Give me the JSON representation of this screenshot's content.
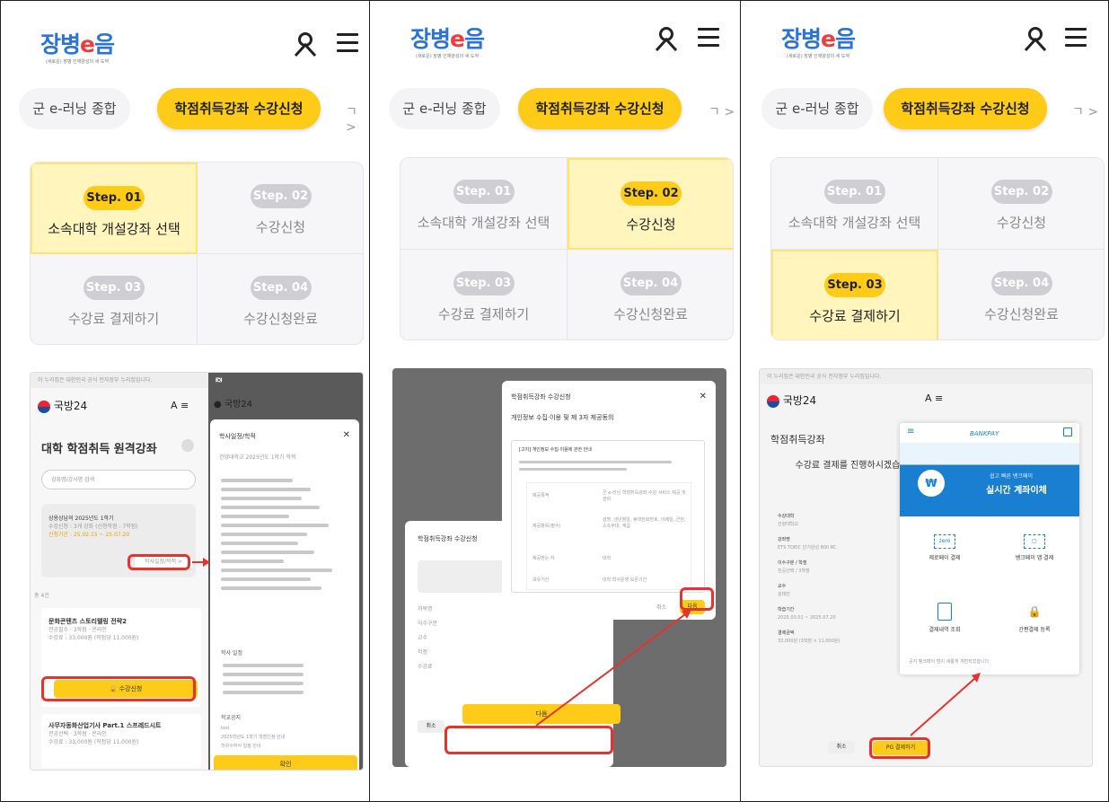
{
  "app": {
    "logo_text_prefix": "장병",
    "logo_text_e": "e",
    "logo_text_suffix": "음",
    "logo_subtitle": "(새로운) 장병 인재양성의 새 도약"
  },
  "tabs": {
    "general": "군 e-러닝 종합",
    "course": "학점취득강좌 수강신청",
    "more": "ㄱ >"
  },
  "steps": [
    {
      "badge": "Step. 01",
      "label": "소속대학 개설강좌 선택"
    },
    {
      "badge": "Step. 02",
      "label": "수강신청"
    },
    {
      "badge": "Step. 03",
      "label": "수강료 결제하기"
    },
    {
      "badge": "Step. 04",
      "label": "수강신청완료"
    }
  ],
  "panels": [
    {
      "active_step": 1
    },
    {
      "active_step": 2
    },
    {
      "active_step": 3
    }
  ],
  "shot1": {
    "notice": "이 누리집은 대한민국 공식 전자정부 누리집입니다.",
    "brand": "국방24",
    "title": "대학 학점취득 원격강좌",
    "search_placeholder": "강좌명/강사명 검색",
    "semester": "상용상남의 2025년도 1학기",
    "apply_info": "수강신청 : 3개 강좌 (신청학점 : 7학점)",
    "period": "신청기간 : 25.02.15 ~ 25.07.20",
    "schedule_button": "학사일정/학적 >",
    "count": "총 4건",
    "course1": "문화콘텐츠 스토리텔링 전략2",
    "course1_meta": "전공필수 · 3학점 · 온라인",
    "course1_fee": "수강료 : 33,000원 (학점당 11,000원)",
    "apply_button": "수강신청",
    "course2": "사무자동화산업기사 Part.1 스프레드시트",
    "course2_meta": "전공선택 · 3학점 · 온라인",
    "course2_fee": "수강료 : 33,000원 (학점당 11,000원)",
    "modal_header": "학사일정/학적",
    "modal_subtitle": "건양대학교 2025년도 1학기 학적",
    "modal_section1": "학사 일정",
    "modal_section2": "학교공지",
    "notice_items": [
      "test",
      "2025학년도 1학기 학점인정 안내",
      "학위수여식 일정 안내"
    ],
    "confirm": "확인"
  },
  "shot2": {
    "back_title": "학점취득강좌 수강신청",
    "modal_title": "학점취득강좌 수강신청",
    "consent_title": "개인정보 수집·이용 및 제 3자 제공동의",
    "consent_box": "[고지] 개인정보 수집·이용에 관한 안내",
    "rows": [
      [
        "제공목적",
        "군 e-러닝 학점취득강좌 수강 서비스 제공 및 관리"
      ],
      [
        "제공항목(필수)",
        "성명, 생년월일, 휴대전화번호, 이메일, 군번, 소속부대, 계급"
      ],
      [
        "제공받는 자",
        "대학"
      ],
      [
        "보유기간",
        "대학 학사운영 보존기간"
      ]
    ],
    "cancel": "취소",
    "agree": "다음",
    "back_cancel": "취소",
    "back_next": "다음",
    "back_fields": [
      "과목명",
      "이수구분",
      "교수",
      "학점",
      "수강료"
    ]
  },
  "shot3": {
    "notice": "이 누리집은 대한민국 공식 전자정부 누리집입니다.",
    "brand": "국방24",
    "title": "학점취득강좌",
    "pay_question": "수강료 결제를 진행하시겠습니까?",
    "fields": [
      "수강대학",
      "강좌명",
      "이수구분 / 학점",
      "교수",
      "학습기간",
      "결제금액"
    ],
    "values": [
      "건양대학교",
      "ETS TOEIC 단기완성 800 RC",
      "전공선택 / 3학점",
      "김태민",
      "2025.03.01 ~ 2025.07.20",
      "33,000원 (3학점 × 11,000원)"
    ],
    "bankpay_logo": "BANKPAY",
    "bankpay_tagline": "쉽고 빠른 뱅크페이",
    "bankpay_title": "실시간 계좌이체",
    "options": [
      "제로페이 결제",
      "뱅크페이 앱 결제",
      "결제내역 조회",
      "간편결제 등록"
    ],
    "bankpay_notice": "공지 뱅크페이 범이 새롭게 개편되었습니다.",
    "cancel": "취소",
    "pay": "PG 결제하기"
  },
  "colors": {
    "accent": "#fdcb18",
    "active_bg": "#fff5bd",
    "highlight": "#e8322f",
    "bankpay": "#1a7fd1"
  }
}
